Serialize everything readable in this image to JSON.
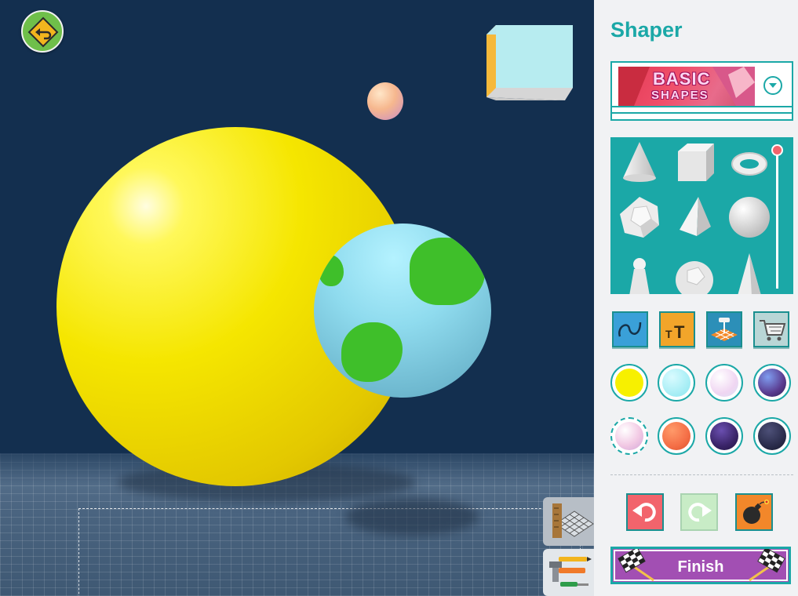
{
  "app": {
    "title": "Shaper"
  },
  "category": {
    "banner_line1": "BASIC",
    "banner_line2": "SHAPES",
    "icon": "chevron-down-icon"
  },
  "shapes": [
    {
      "name": "cone"
    },
    {
      "name": "cube"
    },
    {
      "name": "torus"
    },
    {
      "name": "dodecahedron"
    },
    {
      "name": "pyramid"
    },
    {
      "name": "sphere"
    },
    {
      "name": "pawn"
    },
    {
      "name": "geodesic-sphere"
    },
    {
      "name": "spike-cone"
    }
  ],
  "tools": [
    {
      "name": "curve-tool",
      "icon": "squiggle-icon",
      "color": "#3aa0d8"
    },
    {
      "name": "text-tool",
      "icon": "text-size-icon",
      "color": "#f2a52a"
    },
    {
      "name": "grid-tool",
      "icon": "grid-pin-icon",
      "color": "#2c8fb8"
    },
    {
      "name": "shop-tool",
      "icon": "cart-icon",
      "color": "#b9d6d6"
    }
  ],
  "colors": [
    "#f7f000",
    "#9ef0f4",
    "#f4e8f4",
    "#5a3b8f",
    "#f2c9e4",
    "#f46e46",
    "#3a2468",
    "#2b2d4c"
  ],
  "actions": {
    "undo_icon": "undo-icon",
    "redo_icon": "redo-icon",
    "delete_icon": "bomb-icon"
  },
  "finish": {
    "label": "Finish"
  },
  "viewport": {
    "back_icon": "back-arrow-icon",
    "mode_grid_icon": "ruler-grid-icon",
    "mode_tools_icon": "tools-icon"
  }
}
